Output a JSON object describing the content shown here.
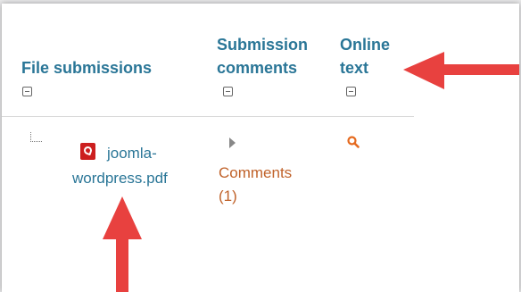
{
  "table": {
    "headers": {
      "file_submissions": "File submissions",
      "submission_comments_line1": "Submission",
      "submission_comments_line2": "comments",
      "online_text_line1": "Online",
      "online_text_line2": "text"
    },
    "row": {
      "file_name_line1": "joomla-",
      "file_name_line2": "wordpress.pdf",
      "comments_line1": "Comments",
      "comments_line2": "(1)"
    }
  },
  "icons": {
    "collapse": "collapse-icon",
    "pdf": "pdf-file-icon",
    "expand": "expand-triangle-icon",
    "search": "magnifier-icon",
    "annotation_arrow": "red-arrow-annotation"
  },
  "colors": {
    "header_text": "#2a7697",
    "link_text": "#2a7697",
    "comments_text": "#c0622a",
    "annotation_arrow": "#e8413f"
  }
}
